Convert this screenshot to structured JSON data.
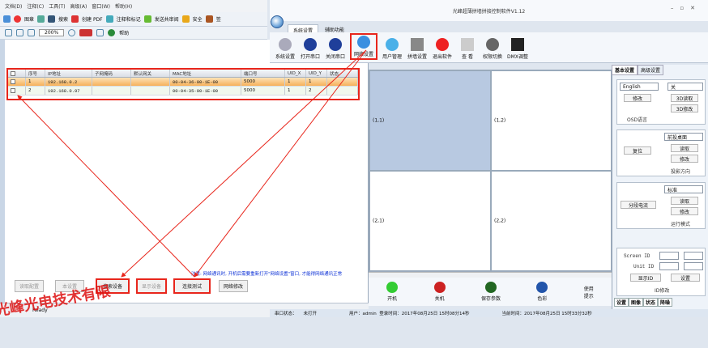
{
  "left_app": {
    "menu": [
      "文档(D)",
      "注释(C)",
      "工具(T)",
      "高级(A)",
      "窗口(W)",
      "帮助(H)"
    ],
    "toolbar": [
      "图章",
      "搜索",
      "创建 PDF",
      "注释和标记",
      "发送共审阅",
      "安全",
      "签"
    ],
    "toolbar2": {
      "zoom": "200%",
      "help": "帮助"
    },
    "table": {
      "headers": [
        "序号",
        "IP地址",
        "子网掩码",
        "默认网关",
        "MAC地址",
        "端口号",
        "UID_X",
        "UID_Y",
        "状态"
      ],
      "rows": [
        [
          "1",
          "192.168.0.2",
          "",
          "",
          "00-04-36-00-1E-00",
          "5000",
          "1",
          "1",
          ""
        ],
        [
          "2",
          "192.168.0.97",
          "",
          "",
          "00-04-35-00-1E-00",
          "5000",
          "1",
          "2",
          ""
        ]
      ]
    },
    "notice": "注意: 网络通讯时, 开机后需要重新打开\"网络设置\"窗口, 才能得网络通讯正常",
    "buttons": {
      "b1": "读取配置",
      "b2": "本设置",
      "search": "搜索设备",
      "show": "显示设备",
      "test": "连接测试",
      "modify": "网络修改"
    },
    "status": "Ready",
    "stamp": "光峰光电技术有限"
  },
  "right_app": {
    "title": "光峰超薄拼墙拼接控制软件V1.12",
    "tabs": [
      "系统设置",
      "辅助功能"
    ],
    "ribbon": [
      "系统设置",
      "打开串口",
      "关闭串口",
      "网络设置",
      "用户管理",
      "拼墙设置",
      "退出软件",
      "查 看",
      "权限切换",
      "DMX调整"
    ],
    "grid_cells": [
      "(1,1)",
      "(1,2)",
      "(2,1)",
      "(2,2)"
    ],
    "bottom_buttons": [
      "开机",
      "关机",
      "保存参数",
      "色彩",
      "使用\n提示"
    ],
    "panel_tabs": [
      "基本设置",
      "高级设置"
    ],
    "panel": {
      "lang": "English",
      "off": "关",
      "modify": "修改",
      "osd_modify": "3D修改",
      "osd_read": "3D读取",
      "osd_lang": "OSD语言",
      "desktop": "前投桌面",
      "read": "读取",
      "modify2": "修改",
      "reset": "复位",
      "proj_dir": "投影方向",
      "std": "标准",
      "read2": "读取",
      "modify3": "修改",
      "split": "分段电流",
      "run_mode": "运行模式",
      "screen_id": "Screen ID",
      "unit_id": "Unit ID",
      "show_id": "显示ID",
      "set": "设置",
      "id_modify": "ID修改"
    },
    "bottom_tabs": [
      "设置",
      "图像",
      "状态",
      "降噪"
    ],
    "status": {
      "port": "串口状态：",
      "open": "未打开",
      "user": "用户：admin",
      "login": "登录时间：2017年08月25日 15时08分14秒",
      "now": "当前时间：2017年08月25日 15时33分32秒"
    }
  },
  "colors": {
    "highlight": "#e8261c",
    "selected_cell": "#b8c9e1"
  }
}
